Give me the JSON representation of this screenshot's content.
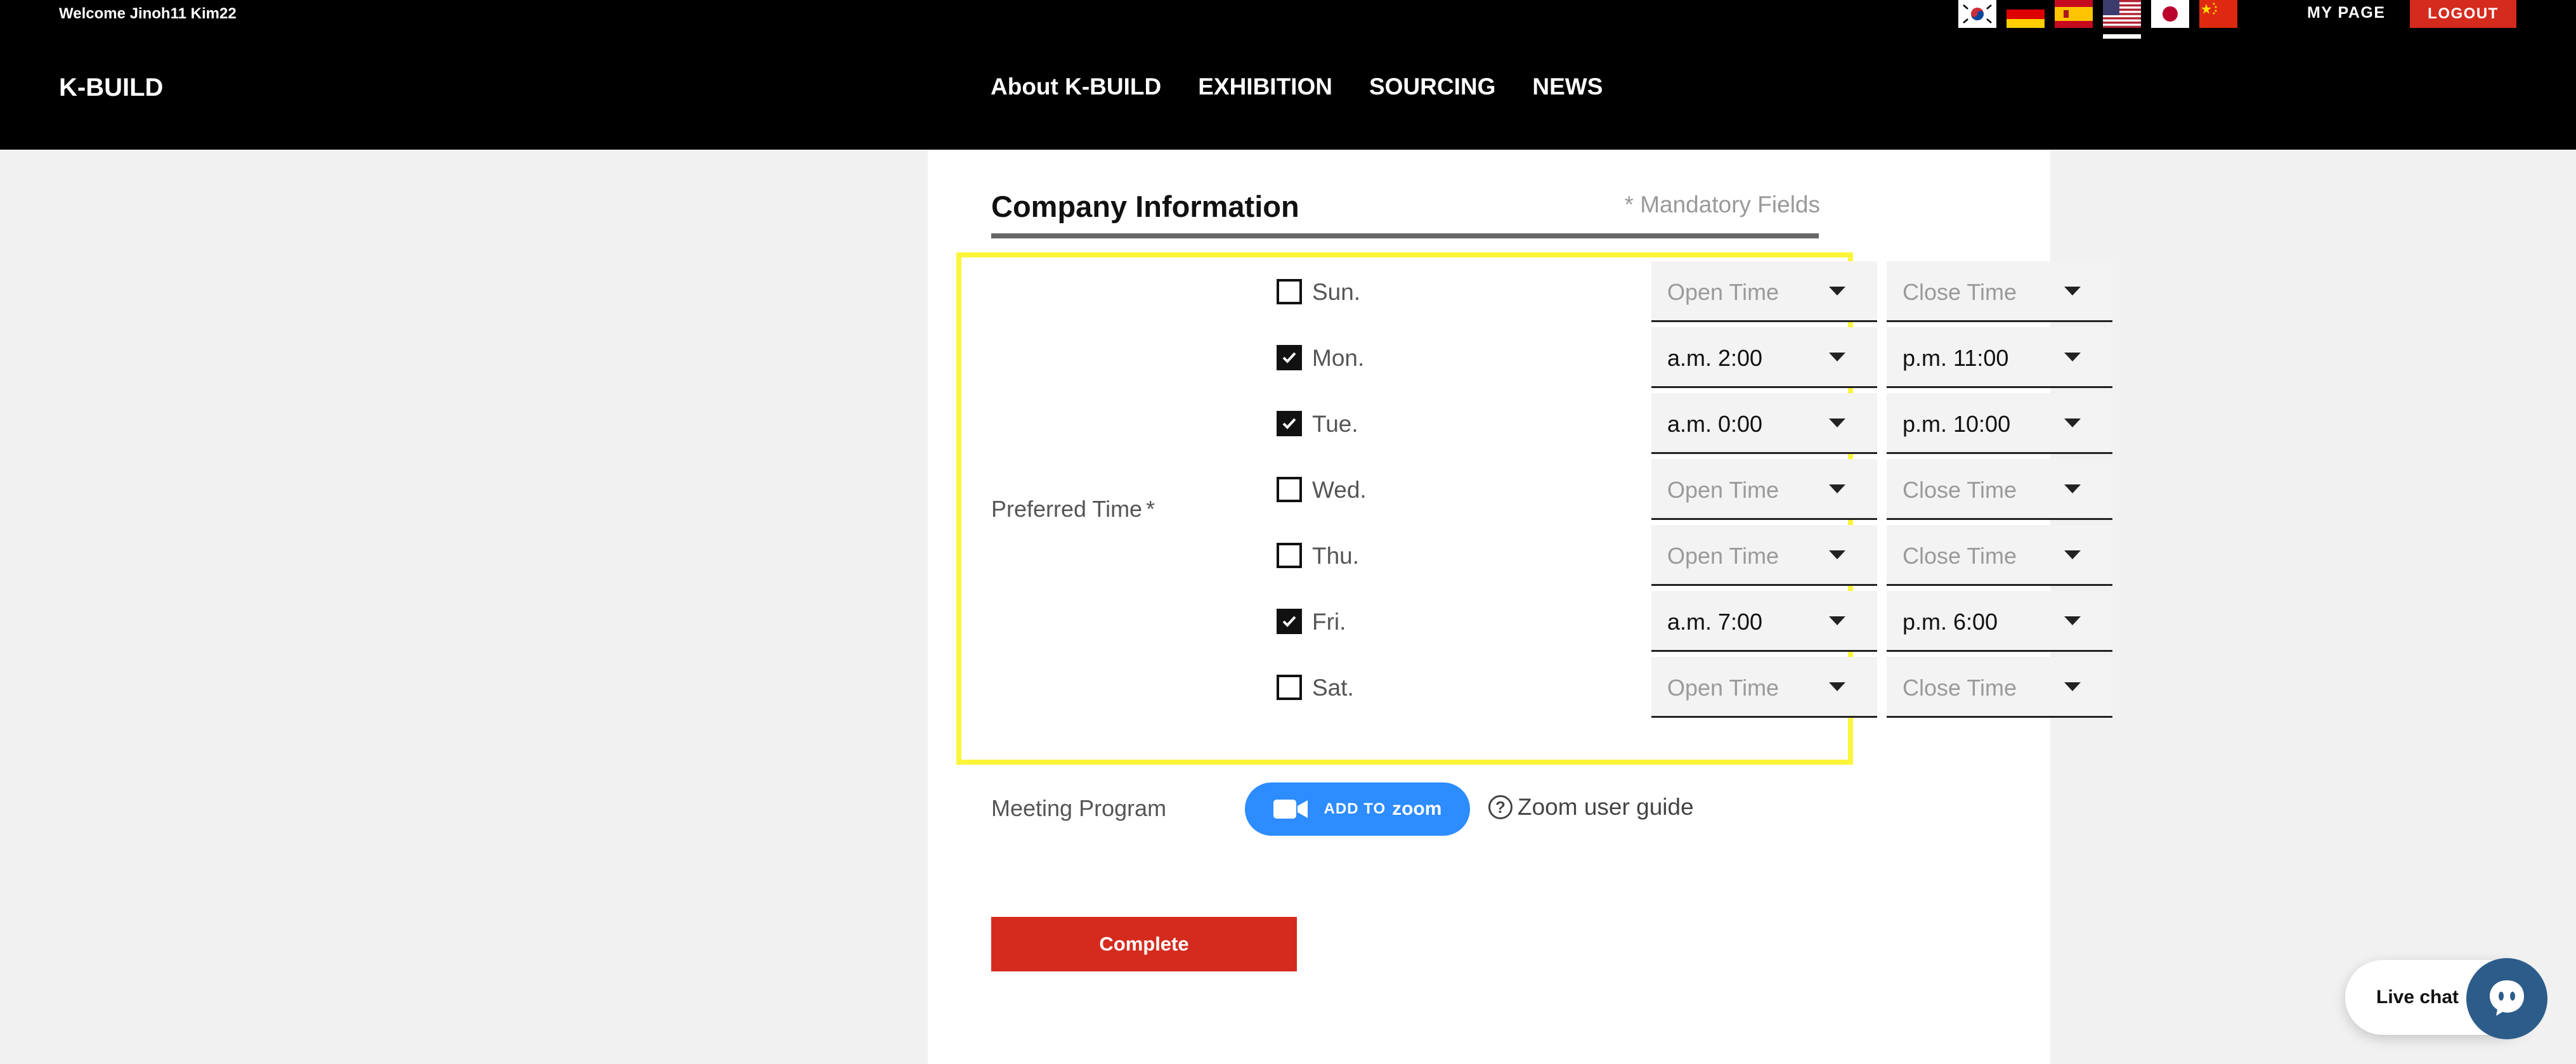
{
  "header": {
    "welcome": "Welcome Jinoh11 Kim22",
    "logo": "K-BUILD",
    "my_page": "MY PAGE",
    "logout": "LOGOUT",
    "nav": [
      "About K-BUILD",
      "EXHIBITION",
      "SOURCING",
      "NEWS"
    ],
    "languages": [
      {
        "icon": "korea-flag-icon"
      },
      {
        "icon": "germany-flag-icon"
      },
      {
        "icon": "spain-flag-icon"
      },
      {
        "icon": "usa-flag-icon",
        "selected": true
      },
      {
        "icon": "japan-flag-icon"
      },
      {
        "icon": "china-flag-icon"
      }
    ]
  },
  "form": {
    "section_title": "Company Information",
    "mandatory_note": "* Mandatory Fields",
    "preferred_time_label": "Preferred Time",
    "required_mark": "*",
    "days": [
      {
        "label": "Sun.",
        "checked": false,
        "open": "Open Time",
        "close": "Close Time"
      },
      {
        "label": "Mon.",
        "checked": true,
        "open": "a.m. 2:00",
        "close": "p.m. 11:00"
      },
      {
        "label": "Tue.",
        "checked": true,
        "open": "a.m. 0:00",
        "close": "p.m. 10:00"
      },
      {
        "label": "Wed.",
        "checked": false,
        "open": "Open Time",
        "close": "Close Time"
      },
      {
        "label": "Thu.",
        "checked": false,
        "open": "Open Time",
        "close": "Close Time"
      },
      {
        "label": "Fri.",
        "checked": true,
        "open": "a.m. 7:00",
        "close": "p.m. 6:00"
      },
      {
        "label": "Sat.",
        "checked": false,
        "open": "Open Time",
        "close": "Close Time"
      }
    ],
    "meeting_program_label": "Meeting Program",
    "zoom_button": {
      "prefix": "ADD TO",
      "brand": "zoom"
    },
    "zoom_guide": "Zoom user guide",
    "complete_button": "Complete"
  },
  "live_chat": {
    "label": "Live chat"
  },
  "colors": {
    "header_bg": "#000000",
    "accent_red": "#d52b1e",
    "zoom_blue": "#2d8cff",
    "highlight_yellow": "#fbf53a",
    "chat_blue": "#2c5c8a"
  }
}
